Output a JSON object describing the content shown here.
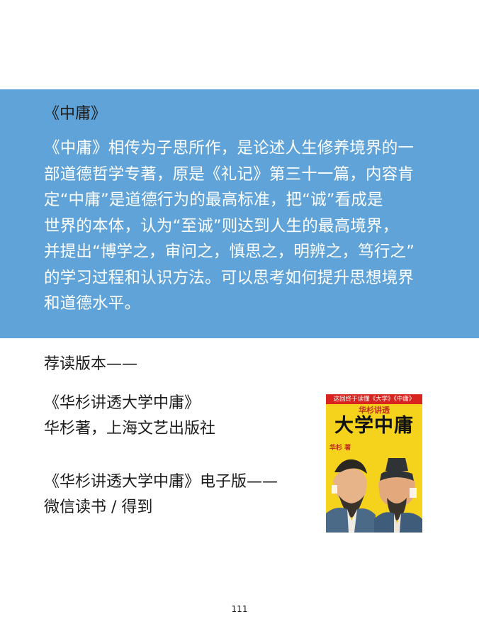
{
  "section": {
    "title": "《中庸》",
    "body_lines": [
      "《中庸》相传为子思所作，是论述人生修养境界的一",
      "部道德哲学专著，原是《礼记》第三十一篇，内容肯",
      "定“中庸”是道德行为的最高标准，把“诚”看成是",
      "世界的本体，认为“至诚”则达到人生的最高境界，",
      "并提出“博学之，审问之，慎思之，明辨之，笃行之”",
      "的学习过程和认识方法。可以思考如何提升思想境界",
      "和道德水平。"
    ]
  },
  "recommend": {
    "label": "荐读版本——",
    "print": {
      "title": "《华杉讲透大学中庸》",
      "publisher": "华杉著，上海文艺出版社"
    },
    "ebook": {
      "title": "《华杉讲透大学中庸》电子版——",
      "platforms": "微信读书 / 得到"
    }
  },
  "cover": {
    "band_text": "这回终于读懂《大学》《中庸》",
    "subtitle": "华杉讲透",
    "main_title": "大学中庸",
    "author": "华杉 著",
    "background_color": "#f5d21c",
    "band_color": "#d8241f"
  },
  "page_number": "111",
  "colors": {
    "panel": "#5fa3d8",
    "body_text": "#ffffff"
  }
}
